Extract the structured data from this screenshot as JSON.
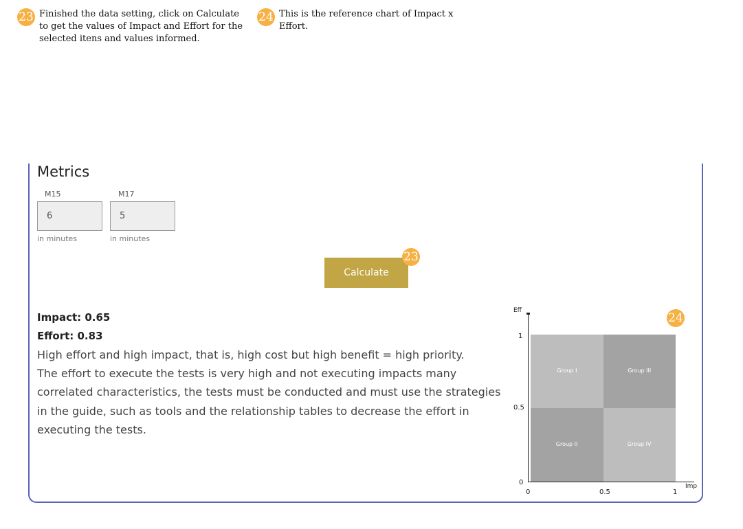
{
  "annotations": [
    {
      "number": "23",
      "text_lines": [
        "Finished the data setting, click on Calculate",
        "to get the values of Impact and Effort for the",
        "selected itens and values informed."
      ]
    },
    {
      "number": "24",
      "text_lines": [
        "This is the reference chart of Impact x",
        "Effort."
      ]
    }
  ],
  "badge_color": "#f6b044",
  "metrics": {
    "title": "Metrics",
    "fields": [
      {
        "label": "M15",
        "value": "6",
        "hint": "in minutes"
      },
      {
        "label": "M17",
        "value": "5",
        "hint": "in minutes"
      }
    ]
  },
  "calculate": {
    "label": "Calculate",
    "color": "#c2a544"
  },
  "results": {
    "impact": "Impact: 0.65",
    "effort": "Effort: 0.83",
    "description_lines": [
      "High effort and high impact, that is, high cost but high benefit = high priority.",
      "The effort to execute the tests is very high and not executing impacts many",
      "correlated characteristics, the tests must be conducted and must use the strategies",
      "in the guide, such as tools and the relationship tables to decrease the effort in",
      "executing the tests."
    ]
  },
  "chart_data": {
    "type": "heatmap",
    "xlabel": "Imp",
    "ylabel": "Eff",
    "xlim": [
      0,
      1
    ],
    "ylim": [
      0,
      1
    ],
    "x_ticks": [
      "0",
      "0.5",
      "1"
    ],
    "y_ticks": [
      "0",
      "0.5",
      "1"
    ],
    "quadrants": [
      {
        "name": "Group I",
        "x": [
          0,
          0.5
        ],
        "y": [
          0.5,
          1
        ],
        "color": "#bdbdbd"
      },
      {
        "name": "Group III",
        "x": [
          0.5,
          1
        ],
        "y": [
          0.5,
          1
        ],
        "color": "#a3a3a3"
      },
      {
        "name": "Group II",
        "x": [
          0,
          0.5
        ],
        "y": [
          0,
          0.5
        ],
        "color": "#a3a3a3"
      },
      {
        "name": "Group IV",
        "x": [
          0.5,
          1
        ],
        "y": [
          0,
          0.5
        ],
        "color": "#bdbdbd"
      }
    ]
  }
}
